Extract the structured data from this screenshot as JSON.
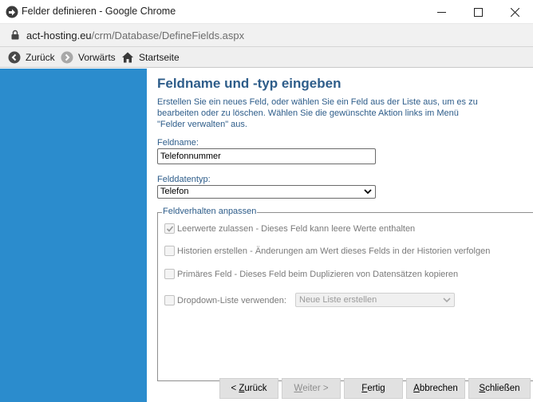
{
  "window": {
    "title": "Felder definieren - Google Chrome"
  },
  "address": {
    "host": "act-hosting.eu",
    "path": "/crm/Database/DefineFields.aspx"
  },
  "toolbar": {
    "back_label": "Zurück",
    "forward_label": "Vorwärts",
    "home_label": "Startseite"
  },
  "page": {
    "title": "Feldname und -typ eingeben",
    "intro": "Erstellen Sie ein neues Feld, oder wählen Sie ein Feld aus der Liste aus, um es zu bearbeiten oder zu löschen. Wählen Sie die gewünschte Aktion links im Menü \"Felder verwalten\" aus.",
    "fieldname_label": "Feldname:",
    "fieldname_value": "Telefonnummer",
    "datatype_label": "Felddatentyp:",
    "datatype_value": "Telefon"
  },
  "behavior": {
    "legend": "Feldverhalten anpassen",
    "allow_blank": {
      "label": "Leerwerte zulassen - Dieses Feld kann leere Werte enthalten",
      "checked": true
    },
    "history": {
      "label": "Historien erstellen - Änderungen am Wert dieses Felds in der Historien verfolgen",
      "checked": false
    },
    "primary": {
      "label": "Primäres Feld - Dieses Feld beim Duplizieren von Datensätzen kopieren",
      "checked": false
    },
    "dropdown": {
      "label": "Dropdown-Liste verwenden:",
      "checked": false,
      "select_value": "Neue Liste erstellen"
    }
  },
  "buttons": {
    "back": {
      "pre": "< ",
      "mnemonic": "Z",
      "rest": "urück"
    },
    "next": {
      "mnemonic": "W",
      "rest": "eiter >"
    },
    "finish": {
      "mnemonic": "F",
      "rest": "ertig"
    },
    "cancel": {
      "mnemonic": "A",
      "rest": "bbrechen"
    },
    "close": {
      "mnemonic": "S",
      "rest": "chließen"
    }
  }
}
